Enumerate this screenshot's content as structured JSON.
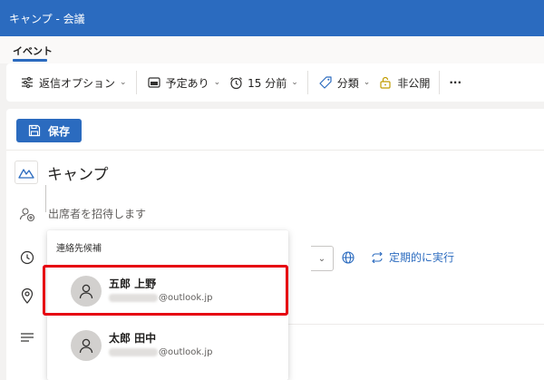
{
  "window": {
    "title": "キャンプ - 会議"
  },
  "tabs": [
    {
      "label": "イベント"
    }
  ],
  "toolbar": {
    "reply_options": "返信オプション",
    "busy_status": "予定あり",
    "reminder": "15 分前",
    "category": "分類",
    "private": "非公開",
    "more": "···"
  },
  "form": {
    "save_label": "保存",
    "event_title": "キャンプ",
    "attendees_placeholder": "出席者を招待します",
    "recurrence_label": "定期的に実行"
  },
  "suggestions": {
    "title": "連絡先候補",
    "contacts": [
      {
        "name": "五郎 上野",
        "email_domain": "@outlook.jp"
      },
      {
        "name": "太郎 田中",
        "email_domain": "@outlook.jp"
      }
    ]
  },
  "colors": {
    "accent": "#2b6bbf",
    "highlight": "#e60012"
  }
}
